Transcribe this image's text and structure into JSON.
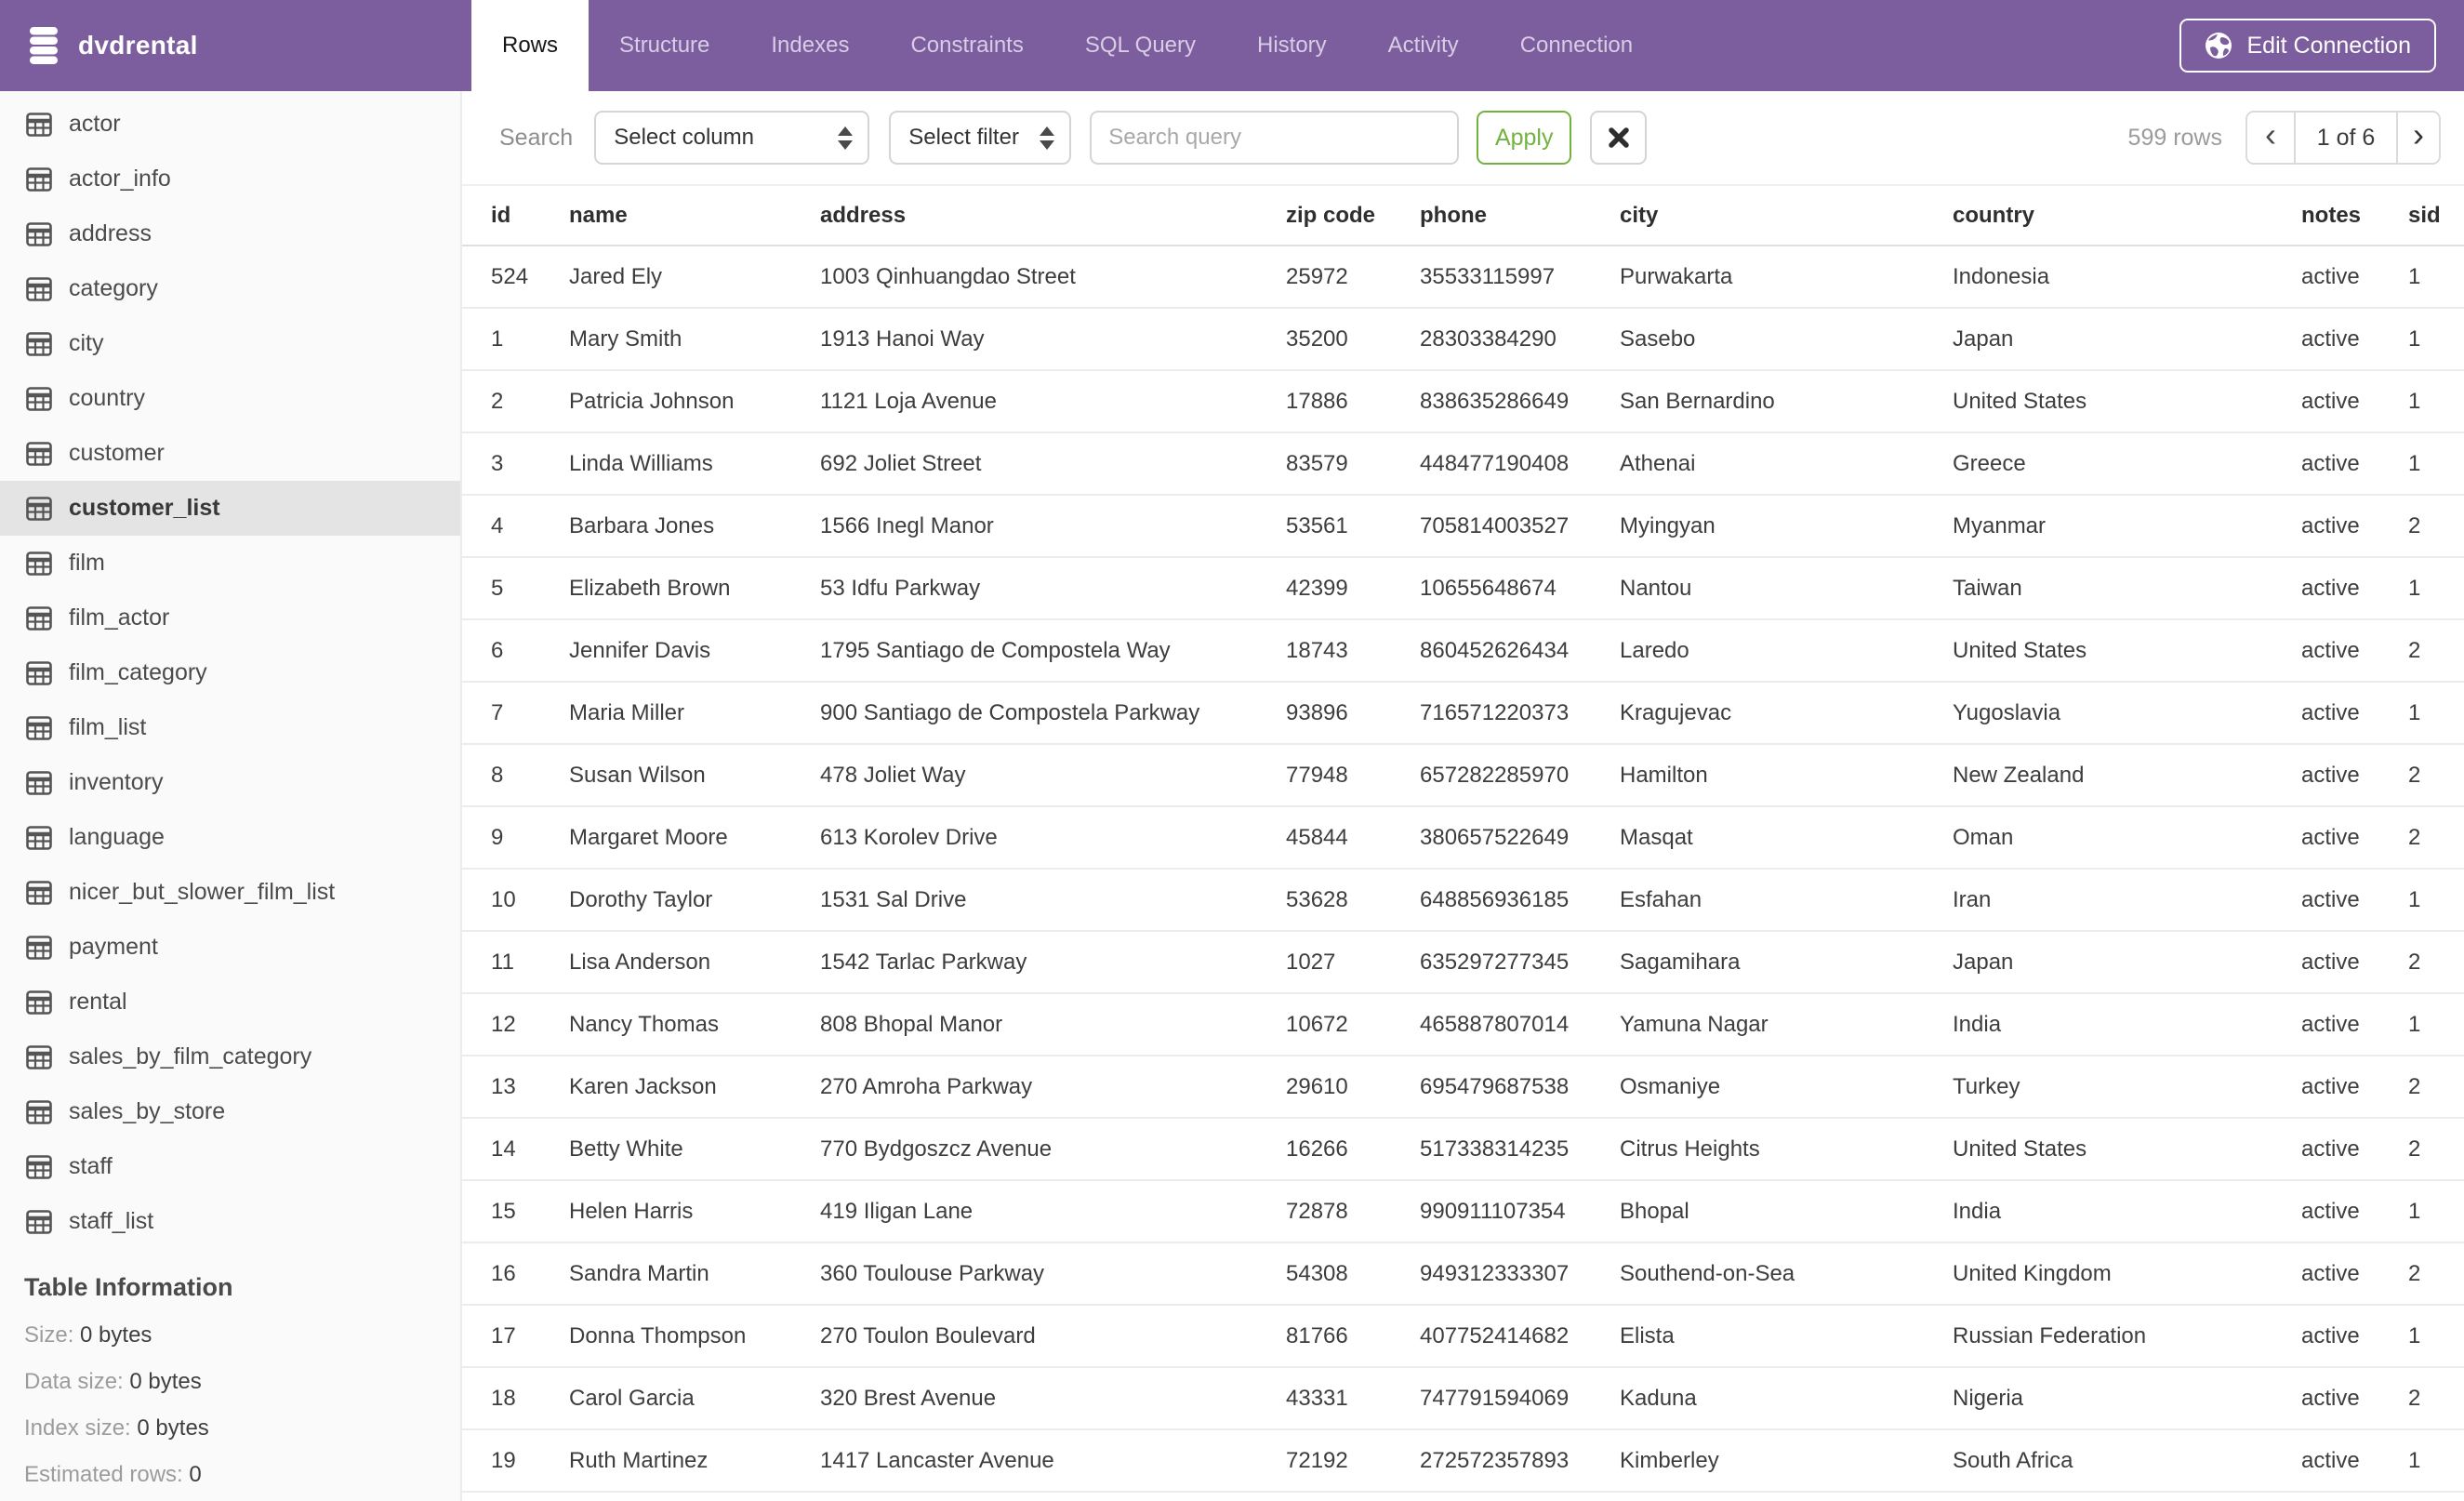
{
  "app": {
    "name": "dvdrental"
  },
  "colors": {
    "header_purple": "#7C5E9E",
    "apply_green": "#72B23F",
    "selected_gray": "#E4E4E4"
  },
  "header": {
    "tabs": [
      {
        "label": "Rows",
        "active": true
      },
      {
        "label": "Structure"
      },
      {
        "label": "Indexes"
      },
      {
        "label": "Constraints"
      },
      {
        "label": "SQL Query"
      },
      {
        "label": "History"
      },
      {
        "label": "Activity"
      },
      {
        "label": "Connection"
      }
    ],
    "edit_connection_label": "Edit Connection"
  },
  "sidebar": {
    "tables": [
      {
        "label": "actor"
      },
      {
        "label": "actor_info"
      },
      {
        "label": "address"
      },
      {
        "label": "category"
      },
      {
        "label": "city"
      },
      {
        "label": "country"
      },
      {
        "label": "customer"
      },
      {
        "label": "customer_list",
        "selected": true
      },
      {
        "label": "film"
      },
      {
        "label": "film_actor"
      },
      {
        "label": "film_category"
      },
      {
        "label": "film_list"
      },
      {
        "label": "inventory"
      },
      {
        "label": "language"
      },
      {
        "label": "nicer_but_slower_film_list"
      },
      {
        "label": "payment"
      },
      {
        "label": "rental"
      },
      {
        "label": "sales_by_film_category"
      },
      {
        "label": "sales_by_store"
      },
      {
        "label": "staff"
      },
      {
        "label": "staff_list"
      }
    ],
    "table_information": {
      "title": "Table Information",
      "items": [
        {
          "label": "Size:",
          "value": "0 bytes"
        },
        {
          "label": "Data size:",
          "value": "0 bytes"
        },
        {
          "label": "Index size:",
          "value": "0 bytes"
        },
        {
          "label": "Estimated rows:",
          "value": "0"
        }
      ]
    }
  },
  "toolbar": {
    "search_label": "Search",
    "column_select_value": "Select column",
    "filter_select_value": "Select filter",
    "query_placeholder": "Search query",
    "apply_label": "Apply",
    "row_count": "599 rows",
    "pagination": {
      "prev": "‹",
      "current": "1 of 6",
      "next": "›"
    }
  },
  "table": {
    "columns": [
      "id",
      "name",
      "address",
      "zip code",
      "phone",
      "city",
      "country",
      "notes",
      "sid"
    ],
    "rows": [
      [
        "524",
        "Jared Ely",
        "1003 Qinhuangdao Street",
        "25972",
        "35533115997",
        "Purwakarta",
        "Indonesia",
        "active",
        "1"
      ],
      [
        "1",
        "Mary Smith",
        "1913 Hanoi Way",
        "35200",
        "28303384290",
        "Sasebo",
        "Japan",
        "active",
        "1"
      ],
      [
        "2",
        "Patricia Johnson",
        "1121 Loja Avenue",
        "17886",
        "838635286649",
        "San Bernardino",
        "United States",
        "active",
        "1"
      ],
      [
        "3",
        "Linda Williams",
        "692 Joliet Street",
        "83579",
        "448477190408",
        "Athenai",
        "Greece",
        "active",
        "1"
      ],
      [
        "4",
        "Barbara Jones",
        "1566 Inegl Manor",
        "53561",
        "705814003527",
        "Myingyan",
        "Myanmar",
        "active",
        "2"
      ],
      [
        "5",
        "Elizabeth Brown",
        "53 Idfu Parkway",
        "42399",
        "10655648674",
        "Nantou",
        "Taiwan",
        "active",
        "1"
      ],
      [
        "6",
        "Jennifer Davis",
        "1795 Santiago de Compostela Way",
        "18743",
        "860452626434",
        "Laredo",
        "United States",
        "active",
        "2"
      ],
      [
        "7",
        "Maria Miller",
        "900 Santiago de Compostela Parkway",
        "93896",
        "716571220373",
        "Kragujevac",
        "Yugoslavia",
        "active",
        "1"
      ],
      [
        "8",
        "Susan Wilson",
        "478 Joliet Way",
        "77948",
        "657282285970",
        "Hamilton",
        "New Zealand",
        "active",
        "2"
      ],
      [
        "9",
        "Margaret Moore",
        "613 Korolev Drive",
        "45844",
        "380657522649",
        "Masqat",
        "Oman",
        "active",
        "2"
      ],
      [
        "10",
        "Dorothy Taylor",
        "1531 Sal Drive",
        "53628",
        "648856936185",
        "Esfahan",
        "Iran",
        "active",
        "1"
      ],
      [
        "11",
        "Lisa Anderson",
        "1542 Tarlac Parkway",
        "1027",
        "635297277345",
        "Sagamihara",
        "Japan",
        "active",
        "2"
      ],
      [
        "12",
        "Nancy Thomas",
        "808 Bhopal Manor",
        "10672",
        "465887807014",
        "Yamuna Nagar",
        "India",
        "active",
        "1"
      ],
      [
        "13",
        "Karen Jackson",
        "270 Amroha Parkway",
        "29610",
        "695479687538",
        "Osmaniye",
        "Turkey",
        "active",
        "2"
      ],
      [
        "14",
        "Betty White",
        "770 Bydgoszcz Avenue",
        "16266",
        "517338314235",
        "Citrus Heights",
        "United States",
        "active",
        "2"
      ],
      [
        "15",
        "Helen Harris",
        "419 Iligan Lane",
        "72878",
        "990911107354",
        "Bhopal",
        "India",
        "active",
        "1"
      ],
      [
        "16",
        "Sandra Martin",
        "360 Toulouse Parkway",
        "54308",
        "949312333307",
        "Southend-on-Sea",
        "United Kingdom",
        "active",
        "2"
      ],
      [
        "17",
        "Donna Thompson",
        "270 Toulon Boulevard",
        "81766",
        "407752414682",
        "Elista",
        "Russian Federation",
        "active",
        "1"
      ],
      [
        "18",
        "Carol Garcia",
        "320 Brest Avenue",
        "43331",
        "747791594069",
        "Kaduna",
        "Nigeria",
        "active",
        "2"
      ],
      [
        "19",
        "Ruth Martinez",
        "1417 Lancaster Avenue",
        "72192",
        "272572357893",
        "Kimberley",
        "South Africa",
        "active",
        "1"
      ]
    ]
  }
}
